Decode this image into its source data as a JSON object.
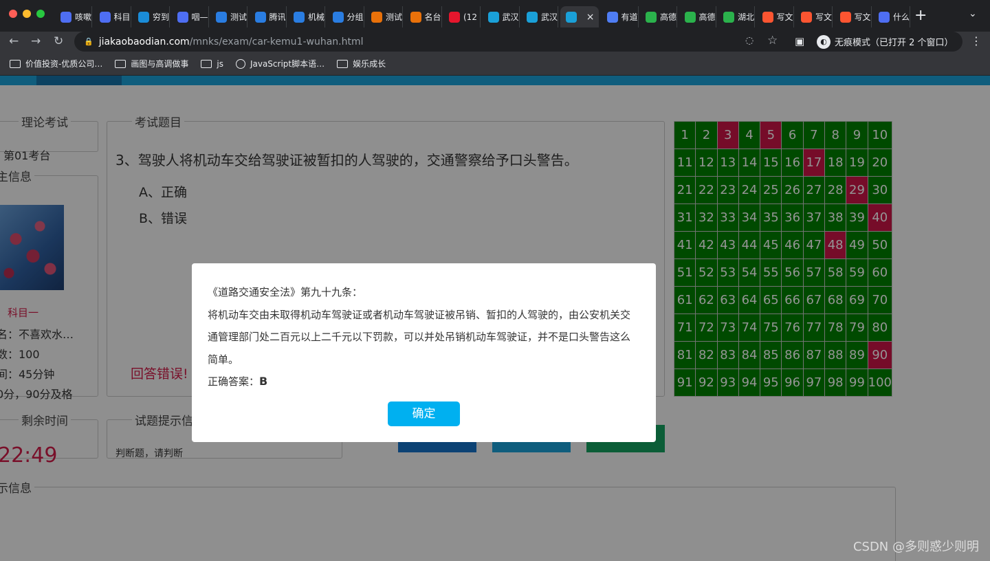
{
  "browser": {
    "tabs": [
      {
        "label": "咳嗽",
        "icon": "baidu-icon",
        "color": "#4e6ef2"
      },
      {
        "label": "科目",
        "icon": "baidu-icon",
        "color": "#4e6ef2"
      },
      {
        "label": "穷到",
        "icon": "bing-icon",
        "color": "#1a8cd8"
      },
      {
        "label": "咽—",
        "icon": "baidu-icon",
        "color": "#4e6ef2"
      },
      {
        "label": "测试",
        "icon": "shield-icon",
        "color": "#2a7de1"
      },
      {
        "label": "腾讯",
        "icon": "shield-icon",
        "color": "#2a7de1"
      },
      {
        "label": "机械",
        "icon": "shield-icon",
        "color": "#2a7de1"
      },
      {
        "label": "分组",
        "icon": "shield-icon",
        "color": "#2a7de1"
      },
      {
        "label": "测试",
        "icon": "circle-icon",
        "color": "#e8710a"
      },
      {
        "label": "名台",
        "icon": "circle-icon",
        "color": "#e8710a"
      },
      {
        "label": "(12",
        "icon": "weibo-icon",
        "color": "#e6162d"
      },
      {
        "label": "武汉",
        "icon": "car-icon",
        "color": "#1aa0d8"
      },
      {
        "label": "武汉",
        "icon": "car-icon",
        "color": "#1aa0d8"
      },
      {
        "label": "",
        "icon": "car-icon",
        "color": "#1aa0d8",
        "active": true
      },
      {
        "label": "有道",
        "icon": "pen-icon",
        "color": "#4f7df3"
      },
      {
        "label": "高德",
        "icon": "gaode-icon",
        "color": "#2bb24c"
      },
      {
        "label": "高德",
        "icon": "gaode-icon",
        "color": "#2bb24c"
      },
      {
        "label": "湖北",
        "icon": "gaode-icon",
        "color": "#2bb24c"
      },
      {
        "label": "写文",
        "icon": "csdn-icon",
        "color": "#fc5531"
      },
      {
        "label": "写文",
        "icon": "csdn-icon",
        "color": "#fc5531"
      },
      {
        "label": "写文",
        "icon": "csdn-icon",
        "color": "#fc5531"
      },
      {
        "label": "什么",
        "icon": "baidu-icon",
        "color": "#4e6ef2"
      }
    ],
    "close_tab": "×",
    "url_host": "jiakaobaodian.com",
    "url_path": "/mnks/exam/car-kemu1-wuhan.html",
    "incognito_label": "无痕模式（已打开 2 个窗口）",
    "bookmarks": [
      {
        "label": "价值投资-优质公司…",
        "icon": "folder-icon"
      },
      {
        "label": "画图与高调做事",
        "icon": "folder-icon"
      },
      {
        "label": "js",
        "icon": "folder-icon"
      },
      {
        "label": "JavaScript脚本语…",
        "icon": "globe-icon"
      },
      {
        "label": "娱乐成长",
        "icon": "folder-icon"
      }
    ]
  },
  "exam": {
    "seat_legend": "理论考试",
    "seat_value": "第01考台",
    "candidate_legend": "主信息",
    "subject": "科目一",
    "info_lines": [
      "名：不喜欢水…",
      "数：100",
      "间：45分钟",
      "0分，90分及格"
    ],
    "question_legend": "考试题目",
    "question": "3、驾驶人将机动车交给驾驶证被暂扣的人驾驶的，交通警察给予口头警告。",
    "options": [
      "A、正确",
      "B、错误"
    ],
    "result_text": "回答错误!",
    "time_legend": "剩余时间",
    "time_value": "22:49",
    "hint_legend": "试题提示信",
    "hint_text": "判断题，请判断",
    "bottom_legend": "示信息",
    "grid_cells": [
      1,
      2,
      3,
      4,
      5,
      6,
      7,
      8,
      9,
      10,
      11,
      12,
      13,
      14,
      15,
      16,
      17,
      18,
      19,
      20,
      21,
      22,
      23,
      24,
      25,
      26,
      27,
      28,
      29,
      30,
      31,
      32,
      33,
      34,
      35,
      36,
      37,
      38,
      39,
      40,
      41,
      42,
      43,
      44,
      45,
      46,
      47,
      48,
      49,
      50,
      51,
      52,
      53,
      54,
      55,
      56,
      57,
      58,
      59,
      60,
      61,
      62,
      63,
      64,
      65,
      66,
      67,
      68,
      69,
      70,
      71,
      72,
      73,
      74,
      75,
      76,
      77,
      78,
      79,
      80,
      81,
      82,
      83,
      84,
      85,
      86,
      87,
      88,
      89,
      90,
      91,
      92,
      93,
      94,
      95,
      96,
      97,
      98,
      99,
      100
    ],
    "wrong_cells": [
      3,
      5,
      17,
      29,
      40,
      48,
      90
    ],
    "correct_color": "#008000",
    "wrong_color": "#cc1548"
  },
  "modal": {
    "title": "《道路交通安全法》第九十九条：",
    "body": "将机动车交由未取得机动车驾驶证或者机动车驾驶证被吊销、暂扣的人驾驶的，由公安机关交通管理部门处二百元以上二千元以下罚款，可以并处吊销机动车驾驶证，并不是口头警告这么简单。",
    "answer_label": "正确答案：",
    "answer_value": "B",
    "ok_label": "确定"
  },
  "watermark": "CSDN @多则惑少则明"
}
